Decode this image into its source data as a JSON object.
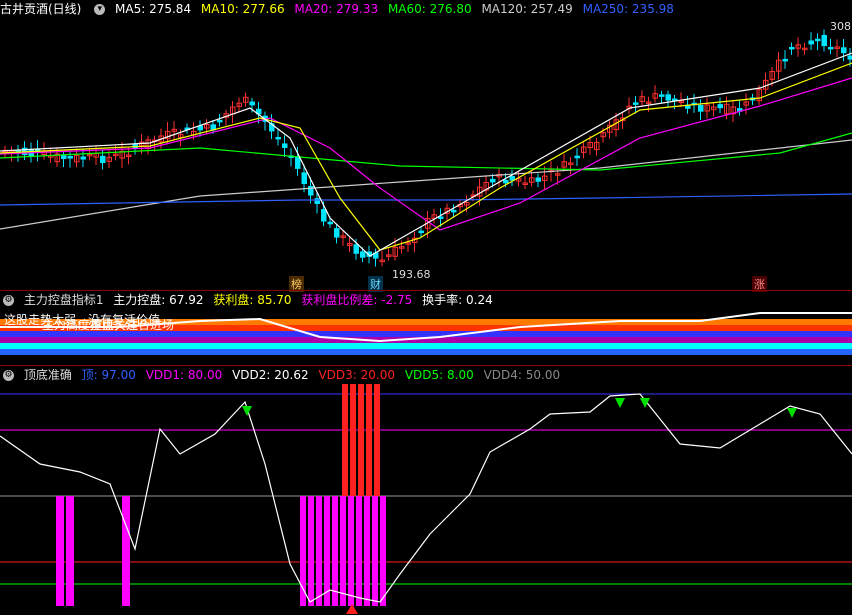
{
  "main": {
    "title": "古井贡酒(日线)",
    "ma": [
      {
        "label": "MA5: 275.84",
        "color": "#ffffff"
      },
      {
        "label": "MA10: 277.66",
        "color": "#ffff00"
      },
      {
        "label": "MA20: 279.33",
        "color": "#ff00ff"
      },
      {
        "label": "MA60: 276.80",
        "color": "#00ff00"
      },
      {
        "label": "MA120: 257.49",
        "color": "#cccccc"
      },
      {
        "label": "MA250: 235.98",
        "color": "#3060ff"
      }
    ],
    "high_label": "308",
    "low_label": "193.68",
    "tags": [
      "榜",
      "财",
      "涨"
    ]
  },
  "panel2": {
    "title": "主力控盘指标1",
    "values": [
      {
        "label": "主力控盘: 67.92",
        "color": "#ffffff"
      },
      {
        "label": "获利盘: 85.70",
        "color": "#ffff00"
      },
      {
        "label": "获利盘比例差: -2.75",
        "color": "#ff00ff"
      },
      {
        "label": "换手率: 0.24",
        "color": "#ffffff"
      }
    ],
    "overlay1": "这股走势太弱，没有复活价值",
    "overlay2": "主力高度控盘，适合进场",
    "overlay3": "重点关注",
    "stripes": [
      "#ff7a00",
      "#ff3300",
      "#3333ff",
      "#aa00aa",
      "#00ffff",
      "#2266ff"
    ]
  },
  "panel3": {
    "title": "顶底准确",
    "values": [
      {
        "label": "顶: 97.00",
        "color": "#3060ff"
      },
      {
        "label": "VDD1: 80.00",
        "color": "#ff00ff"
      },
      {
        "label": "VDD2: 20.62",
        "color": "#ffffff"
      },
      {
        "label": "VDD3: 20.00",
        "color": "#ff2020"
      },
      {
        "label": "VDD5: 8.00",
        "color": "#00ff00"
      },
      {
        "label": "VDD4: 50.00",
        "color": "#888888"
      }
    ]
  }
}
